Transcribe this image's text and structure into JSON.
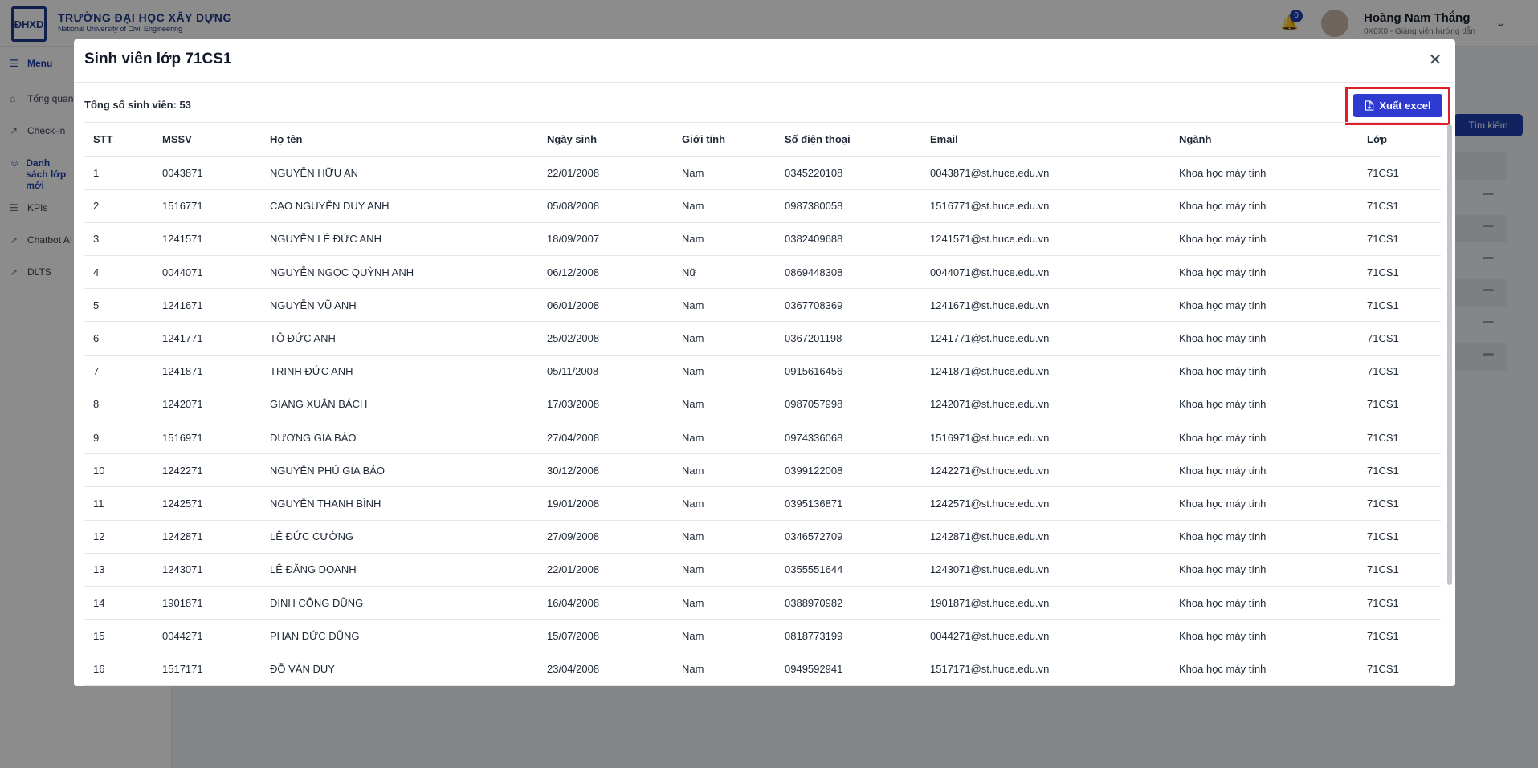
{
  "app": {
    "logo_mark": "ĐHXD",
    "university_name": "TRƯỜNG ĐẠI HỌC XÂY DỰNG",
    "university_sub": "National University of Civil Engineering",
    "notification_count": "0",
    "user_name": "Hoàng Nam Thắng",
    "user_role": "0X0X0 - Giảng viên hướng dẫn"
  },
  "sidebar": {
    "items": [
      {
        "label": "Menu",
        "icon": "menu-icon"
      },
      {
        "label": "Tổng quan",
        "icon": "home-icon"
      },
      {
        "label": "Check-in",
        "icon": "chart-icon"
      },
      {
        "label": "Danh sách lớp mới",
        "icon": "users-icon"
      },
      {
        "label": "KPIs",
        "icon": "list-icon"
      },
      {
        "label": "Chatbot AI",
        "icon": "chart-icon"
      },
      {
        "label": "DLTS",
        "icon": "chart-icon"
      }
    ]
  },
  "background": {
    "search_button": "Tìm kiếm"
  },
  "modal": {
    "title": "Sinh viên lớp 71CS1",
    "close_icon": "close-icon",
    "total_label": "Tổng số sinh viên: 53",
    "export_label": "Xuất excel",
    "export_icon": "file-export-icon",
    "accent_color": "#2f3ad1",
    "highlight_color": "#e11d2a"
  },
  "table": {
    "columns": [
      "STT",
      "MSSV",
      "Họ tên",
      "Ngày sinh",
      "Giới tính",
      "Số điện thoại",
      "Email",
      "Ngành",
      "Lớp"
    ],
    "rows": [
      [
        "1",
        "0043871",
        "NGUYỄN HỮU AN",
        "22/01/2008",
        "Nam",
        "0345220108",
        "0043871@st.huce.edu.vn",
        "Khoa học máy tính",
        "71CS1"
      ],
      [
        "2",
        "1516771",
        "CAO NGUYỄN DUY ANH",
        "05/08/2008",
        "Nam",
        "0987380058",
        "1516771@st.huce.edu.vn",
        "Khoa học máy tính",
        "71CS1"
      ],
      [
        "3",
        "1241571",
        "NGUYỄN LÊ ĐỨC ANH",
        "18/09/2007",
        "Nam",
        "0382409688",
        "1241571@st.huce.edu.vn",
        "Khoa học máy tính",
        "71CS1"
      ],
      [
        "4",
        "0044071",
        "NGUYỄN NGỌC QUỲNH ANH",
        "06/12/2008",
        "Nữ",
        "0869448308",
        "0044071@st.huce.edu.vn",
        "Khoa học máy tính",
        "71CS1"
      ],
      [
        "5",
        "1241671",
        "NGUYỄN VŨ ANH",
        "06/01/2008",
        "Nam",
        "0367708369",
        "1241671@st.huce.edu.vn",
        "Khoa học máy tính",
        "71CS1"
      ],
      [
        "6",
        "1241771",
        "TÔ ĐỨC ANH",
        "25/02/2008",
        "Nam",
        "0367201198",
        "1241771@st.huce.edu.vn",
        "Khoa học máy tính",
        "71CS1"
      ],
      [
        "7",
        "1241871",
        "TRỊNH ĐỨC ANH",
        "05/11/2008",
        "Nam",
        "0915616456",
        "1241871@st.huce.edu.vn",
        "Khoa học máy tính",
        "71CS1"
      ],
      [
        "8",
        "1242071",
        "GIANG XUÂN BÁCH",
        "17/03/2008",
        "Nam",
        "0987057998",
        "1242071@st.huce.edu.vn",
        "Khoa học máy tính",
        "71CS1"
      ],
      [
        "9",
        "1516971",
        "DƯƠNG GIA BẢO",
        "27/04/2008",
        "Nam",
        "0974336068",
        "1516971@st.huce.edu.vn",
        "Khoa học máy tính",
        "71CS1"
      ],
      [
        "10",
        "1242271",
        "NGUYỄN PHÚ GIA BẢO",
        "30/12/2008",
        "Nam",
        "0399122008",
        "1242271@st.huce.edu.vn",
        "Khoa học máy tính",
        "71CS1"
      ],
      [
        "11",
        "1242571",
        "NGUYỄN THANH BÌNH",
        "19/01/2008",
        "Nam",
        "0395136871",
        "1242571@st.huce.edu.vn",
        "Khoa học máy tính",
        "71CS1"
      ],
      [
        "12",
        "1242871",
        "LÊ ĐỨC CƯỜNG",
        "27/09/2008",
        "Nam",
        "0346572709",
        "1242871@st.huce.edu.vn",
        "Khoa học máy tính",
        "71CS1"
      ],
      [
        "13",
        "1243071",
        "LÊ ĐĂNG DOANH",
        "22/01/2008",
        "Nam",
        "0355551644",
        "1243071@st.huce.edu.vn",
        "Khoa học máy tính",
        "71CS1"
      ],
      [
        "14",
        "1901871",
        "ĐINH CÔNG DŨNG",
        "16/04/2008",
        "Nam",
        "0388970982",
        "1901871@st.huce.edu.vn",
        "Khoa học máy tính",
        "71CS1"
      ],
      [
        "15",
        "0044271",
        "PHAN ĐỨC DŨNG",
        "15/07/2008",
        "Nam",
        "0818773199",
        "0044271@st.huce.edu.vn",
        "Khoa học máy tính",
        "71CS1"
      ],
      [
        "16",
        "1517171",
        "ĐỖ VĂN DUY",
        "23/04/2008",
        "Nam",
        "0949592941",
        "1517171@st.huce.edu.vn",
        "Khoa học máy tính",
        "71CS1"
      ]
    ]
  }
}
